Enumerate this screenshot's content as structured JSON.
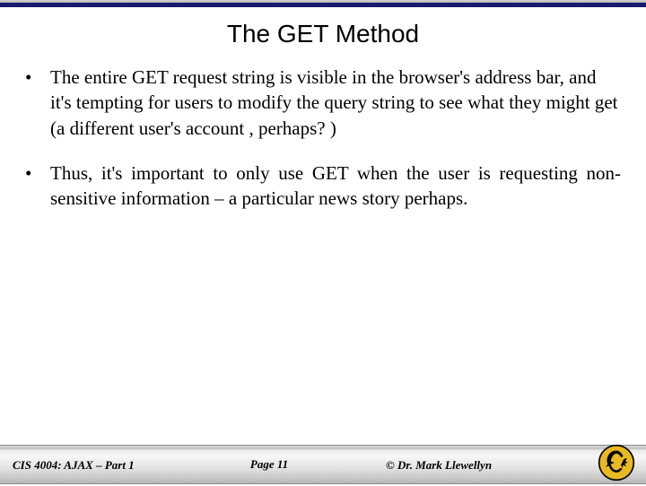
{
  "slide": {
    "title": "The GET Method",
    "bullets": [
      "The entire GET request string is visible in the browser's address bar, and it's tempting for users to modify the query string to see what they might get (a different user's account , perhaps? )",
      "Thus, it's important to only use GET when the user is requesting non-sensitive information – a particular news story perhaps."
    ]
  },
  "footer": {
    "course": "CIS 4004: AJAX – Part 1",
    "page": "Page  11",
    "author": "© Dr. Mark Llewellyn"
  }
}
